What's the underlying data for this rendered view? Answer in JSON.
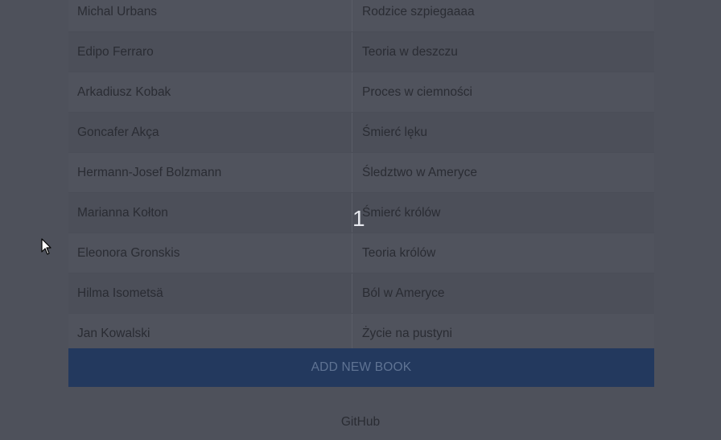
{
  "books": [
    {
      "author": "Michal Urbans",
      "title": "Rodzice szpiegaaaa"
    },
    {
      "author": "Edipo Ferraro",
      "title": "Teoria w deszczu"
    },
    {
      "author": "Arkadiusz Kobak",
      "title": "Proces w ciemności"
    },
    {
      "author": "Goncafer Akça",
      "title": "Śmierć lęku"
    },
    {
      "author": "Hermann-Josef Bolzmann",
      "title": "Śledztwo w Ameryce"
    },
    {
      "author": "Marianna Kołton",
      "title": "Śmierć królów"
    },
    {
      "author": "Eleonora Gronskis",
      "title": "Teoria królów"
    },
    {
      "author": "Hilma Isometsä",
      "title": "Ból w Ameryce"
    },
    {
      "author": "Jan Kowalski",
      "title": "Życie na pustyni"
    }
  ],
  "add_button_label": "ADD NEW BOOK",
  "footer_link": "GitHub",
  "overlay_number": "1"
}
